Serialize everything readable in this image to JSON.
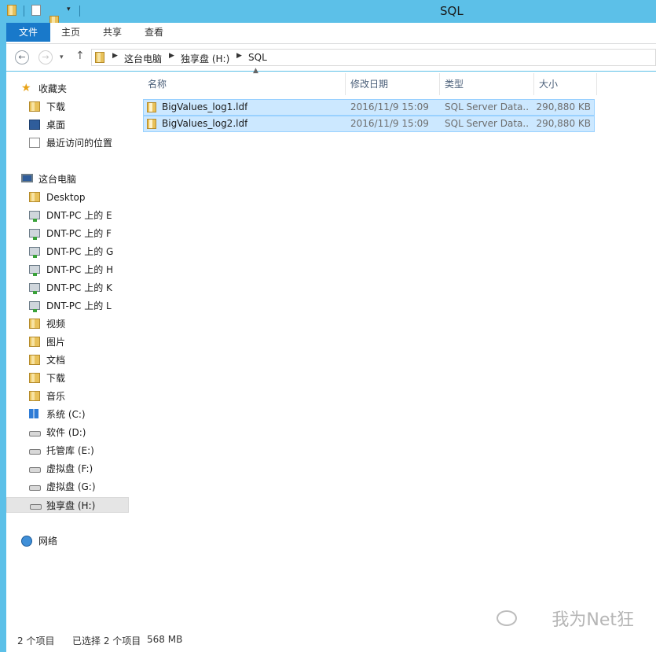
{
  "window": {
    "title": "SQL"
  },
  "ribbon": {
    "tabs": [
      "文件",
      "主页",
      "共享",
      "查看"
    ]
  },
  "address": {
    "path": [
      "这台电脑",
      "独享盘 (H:)",
      "SQL"
    ]
  },
  "sidebar": {
    "favorites": {
      "label": "收藏夹",
      "items": [
        {
          "label": "下载",
          "icon": "download-folder-icon"
        },
        {
          "label": "桌面",
          "icon": "desktop-icon"
        },
        {
          "label": "最近访问的位置",
          "icon": "recent-places-icon"
        }
      ]
    },
    "this_pc": {
      "label": "这台电脑",
      "items": [
        {
          "label": "Desktop",
          "icon": "folder-icon"
        },
        {
          "label": "DNT-PC 上的 E",
          "icon": "network-drive-icon"
        },
        {
          "label": "DNT-PC 上的 F",
          "icon": "network-drive-icon"
        },
        {
          "label": "DNT-PC 上的 G",
          "icon": "network-drive-icon"
        },
        {
          "label": "DNT-PC 上的 H",
          "icon": "network-drive-icon"
        },
        {
          "label": "DNT-PC 上的 K",
          "icon": "network-drive-icon"
        },
        {
          "label": "DNT-PC 上的 L",
          "icon": "network-drive-icon"
        },
        {
          "label": "视频",
          "icon": "videos-folder-icon"
        },
        {
          "label": "图片",
          "icon": "pictures-folder-icon"
        },
        {
          "label": "文档",
          "icon": "documents-folder-icon"
        },
        {
          "label": "下载",
          "icon": "download-folder-icon"
        },
        {
          "label": "音乐",
          "icon": "music-folder-icon"
        },
        {
          "label": "系统 (C:)",
          "icon": "windows-drive-icon"
        },
        {
          "label": "软件 (D:)",
          "icon": "drive-icon"
        },
        {
          "label": "托管库 (E:)",
          "icon": "drive-icon"
        },
        {
          "label": "虚拟盘 (F:)",
          "icon": "drive-icon"
        },
        {
          "label": "虚拟盘 (G:)",
          "icon": "drive-icon"
        },
        {
          "label": "独享盘 (H:)",
          "icon": "drive-icon",
          "selected": true
        }
      ]
    },
    "network": {
      "label": "网络"
    }
  },
  "file_list": {
    "columns": [
      "名称",
      "修改日期",
      "类型",
      "大小"
    ],
    "rows": [
      {
        "name": "BigValues_log1.ldf",
        "date": "2016/11/9 15:09",
        "type": "SQL Server Data...",
        "size": "290,880 KB"
      },
      {
        "name": "BigValues_log2.ldf",
        "date": "2016/11/9 15:09",
        "type": "SQL Server Data...",
        "size": "290,880 KB"
      }
    ]
  },
  "status": {
    "count": "2 个项目",
    "selected": "已选择 2 个项目",
    "size": "568 MB"
  },
  "watermark": "我为Net狂"
}
